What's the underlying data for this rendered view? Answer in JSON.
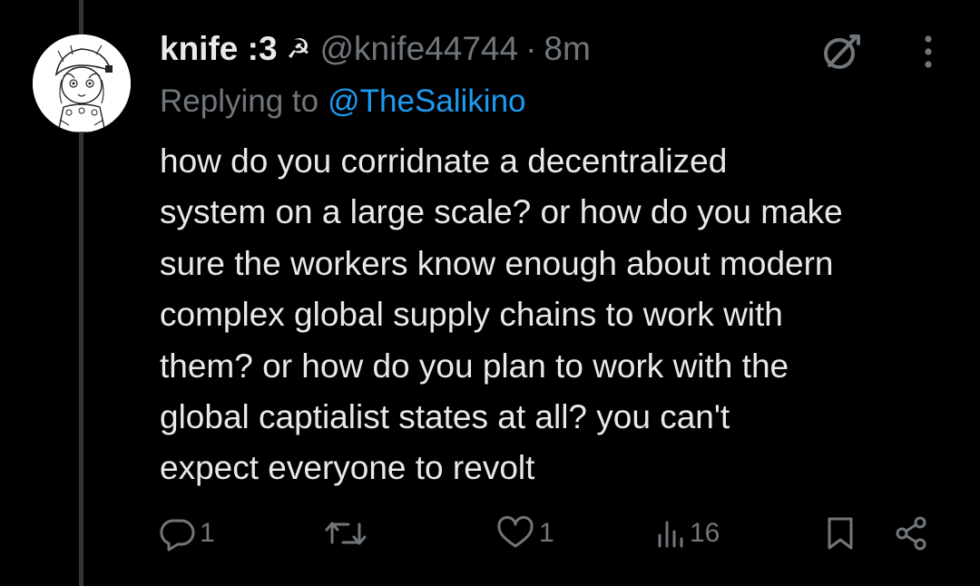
{
  "tweet": {
    "display_name": "knife :3",
    "name_emoji": "☭",
    "handle": "@knife44744",
    "separator": "·",
    "time": "8m",
    "reply_prefix": "Replying to",
    "reply_handle": "@TheSalikino",
    "body_lines": [
      "how do you corridnate a decentralized",
      "system on a large scale? or how do you make",
      "sure the workers know enough about modern",
      "complex global supply chains to work with",
      "them? or how do you plan to work with the",
      "global captialist states at all? you can't",
      "expect everyone to revolt"
    ],
    "actions": {
      "replies": "1",
      "likes": "1",
      "views": "16"
    }
  },
  "colors": {
    "background": "#000000",
    "text": "#e7e9ea",
    "muted": "#71767b",
    "link": "#1d9bf0",
    "thread_line": "#333639"
  },
  "icons": {
    "avatar": "anime-character-avatar",
    "grok": "grok-icon",
    "more": "more-icon",
    "reply": "reply-icon",
    "retweet": "retweet-icon",
    "like": "heart-icon",
    "views": "views-icon",
    "bookmark": "bookmark-icon",
    "share": "share-icon"
  }
}
